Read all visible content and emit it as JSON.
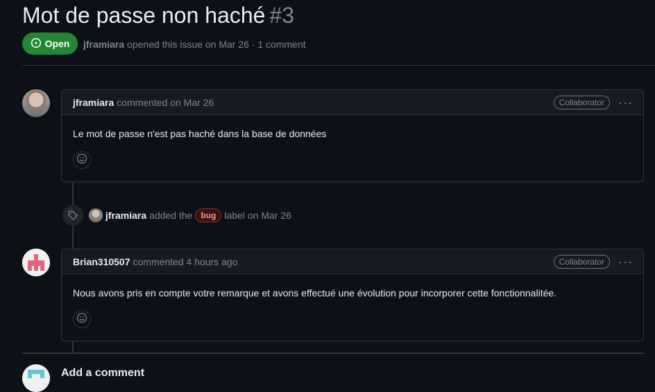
{
  "issue": {
    "title": "Mot de passe non haché",
    "number": "#3",
    "state": "Open",
    "author": "jframiara",
    "meta_text": "opened this issue on Mar 26 · 1 comment"
  },
  "comments": [
    {
      "author": "jframiara",
      "action": "commented on Mar 26",
      "role": "Collaborator",
      "body": "Le mot de passe n'est pas haché dans la base de données"
    },
    {
      "author": "Brian310507",
      "action": "commented 4 hours ago",
      "role": "Collaborator",
      "body": "Nous avons pris en compte votre remarque et avons effectué une évolution pour incorporer cette fonctionnalitée."
    }
  ],
  "event": {
    "author": "jframiara",
    "action_before": "added the",
    "label": "bug",
    "action_after": "label on Mar 26"
  },
  "add_comment": {
    "title": "Add a comment"
  },
  "icons": {
    "state": "issue-opened-icon",
    "more": "kebab-horizontal-icon",
    "reaction": "smiley-icon",
    "event": "tag-icon"
  },
  "colors": {
    "open_green": "#238636",
    "bug_label": "#ff9492",
    "background": "#0d1117"
  }
}
